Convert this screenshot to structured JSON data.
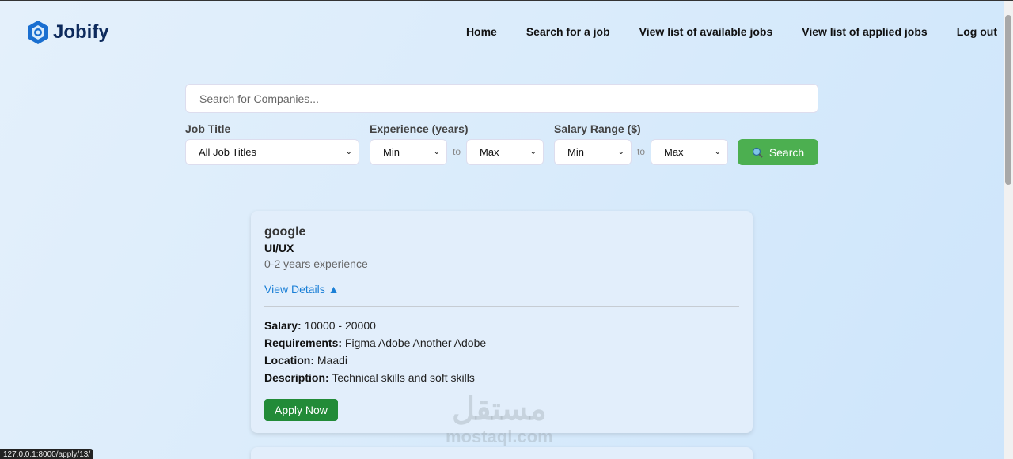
{
  "brand": {
    "name": "Jobify",
    "color": "#1a6fd0"
  },
  "nav": {
    "links": [
      "Home",
      "Search for a job",
      "View list of available jobs",
      "View list of applied jobs",
      "Log out"
    ]
  },
  "search": {
    "placeholder": "Search for Companies...",
    "value": ""
  },
  "filters": {
    "job_title": {
      "label": "Job Title",
      "value": "All Job Titles"
    },
    "experience": {
      "label": "Experience (years)",
      "min": "Min",
      "max": "Max",
      "to": "to"
    },
    "salary": {
      "label": "Salary Range ($)",
      "min": "Min",
      "max": "Max",
      "to": "to"
    },
    "search_button": "Search"
  },
  "jobs": [
    {
      "company": "google",
      "title": "UI/UX",
      "experience": "0-2 years experience",
      "toggle": "View Details ▲",
      "salary_label": "Salary:",
      "salary": "10000 - 20000",
      "requirements_label": "Requirements:",
      "requirements": "Figma Adobe Another Adobe",
      "location_label": "Location:",
      "location": "Maadi",
      "description_label": "Description:",
      "description": "Technical skills and soft skills",
      "apply": "Apply Now"
    }
  ],
  "watermark": {
    "arabic": "مستقل",
    "latin": "mostaql.com"
  },
  "status_url": "127.0.0.1:8000/apply/13/",
  "colors": {
    "accent": "#4caf50",
    "apply": "#228b38",
    "link": "#1a7fd6"
  }
}
